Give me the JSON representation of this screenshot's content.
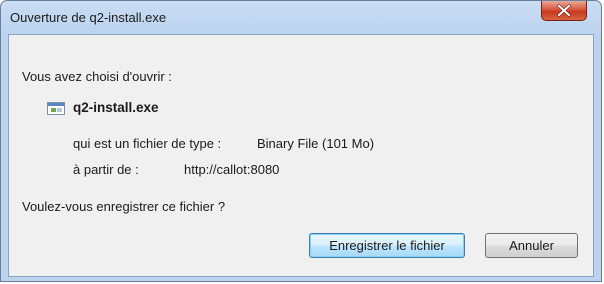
{
  "window": {
    "title": "Ouverture de q2-install.exe"
  },
  "dialog": {
    "intro": "Vous avez choisi d'ouvrir :",
    "file_name": "q2-install.exe",
    "type_label": "qui est un fichier de type :",
    "type_value": "Binary File (101 Mo)",
    "from_label": "à partir de :",
    "from_value": "http://callot:8080",
    "question": "Voulez-vous enregistrer ce fichier ?"
  },
  "buttons": {
    "save_label": "Enregistrer le fichier",
    "cancel_label": "Annuler"
  },
  "icons": {
    "close": "close-icon",
    "file": "file-icon"
  },
  "colors": {
    "close_button": "#c7381d",
    "default_button_border": "#3c7fb1",
    "title_bar": "#bcd3ee"
  }
}
